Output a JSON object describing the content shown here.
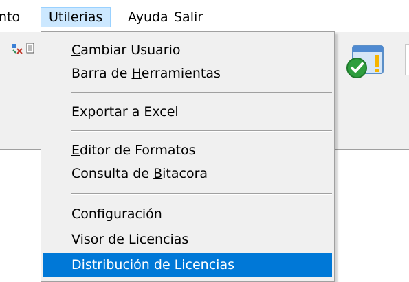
{
  "menubar": {
    "items": [
      {
        "label": "nto"
      },
      {
        "label": "Utilerias",
        "active": true
      },
      {
        "label": "Ayuda"
      },
      {
        "label": "Salir"
      }
    ]
  },
  "toolbar": {
    "icons": [
      "tool-icon",
      "document-icon",
      "check-window-icon"
    ]
  },
  "dropdown": {
    "groups": [
      {
        "items": [
          {
            "pre": "",
            "mn": "C",
            "post": "ambiar Usuario"
          },
          {
            "pre": "Barra de ",
            "mn": "H",
            "post": "erramientas"
          }
        ]
      },
      {
        "items": [
          {
            "pre": "",
            "mn": "E",
            "post": "xportar a Excel"
          }
        ]
      },
      {
        "items": [
          {
            "pre": "",
            "mn": "E",
            "post": "ditor de Formatos"
          },
          {
            "pre": "Consulta de ",
            "mn": "B",
            "post": "itacora"
          }
        ]
      },
      {
        "items": [
          {
            "pre": "Configuración",
            "mn": "",
            "post": ""
          },
          {
            "pre": "Visor de Licencias",
            "mn": "",
            "post": ""
          },
          {
            "pre": "Distribución de Licencias",
            "mn": "",
            "post": "",
            "highlighted": true
          }
        ]
      }
    ]
  },
  "colors": {
    "menu_active_bg": "#cce8ff",
    "menu_active_border": "#99d1ff",
    "highlight_bg": "#0078d7",
    "highlight_text": "#ffffff",
    "menu_bg": "#f0f0f0"
  }
}
